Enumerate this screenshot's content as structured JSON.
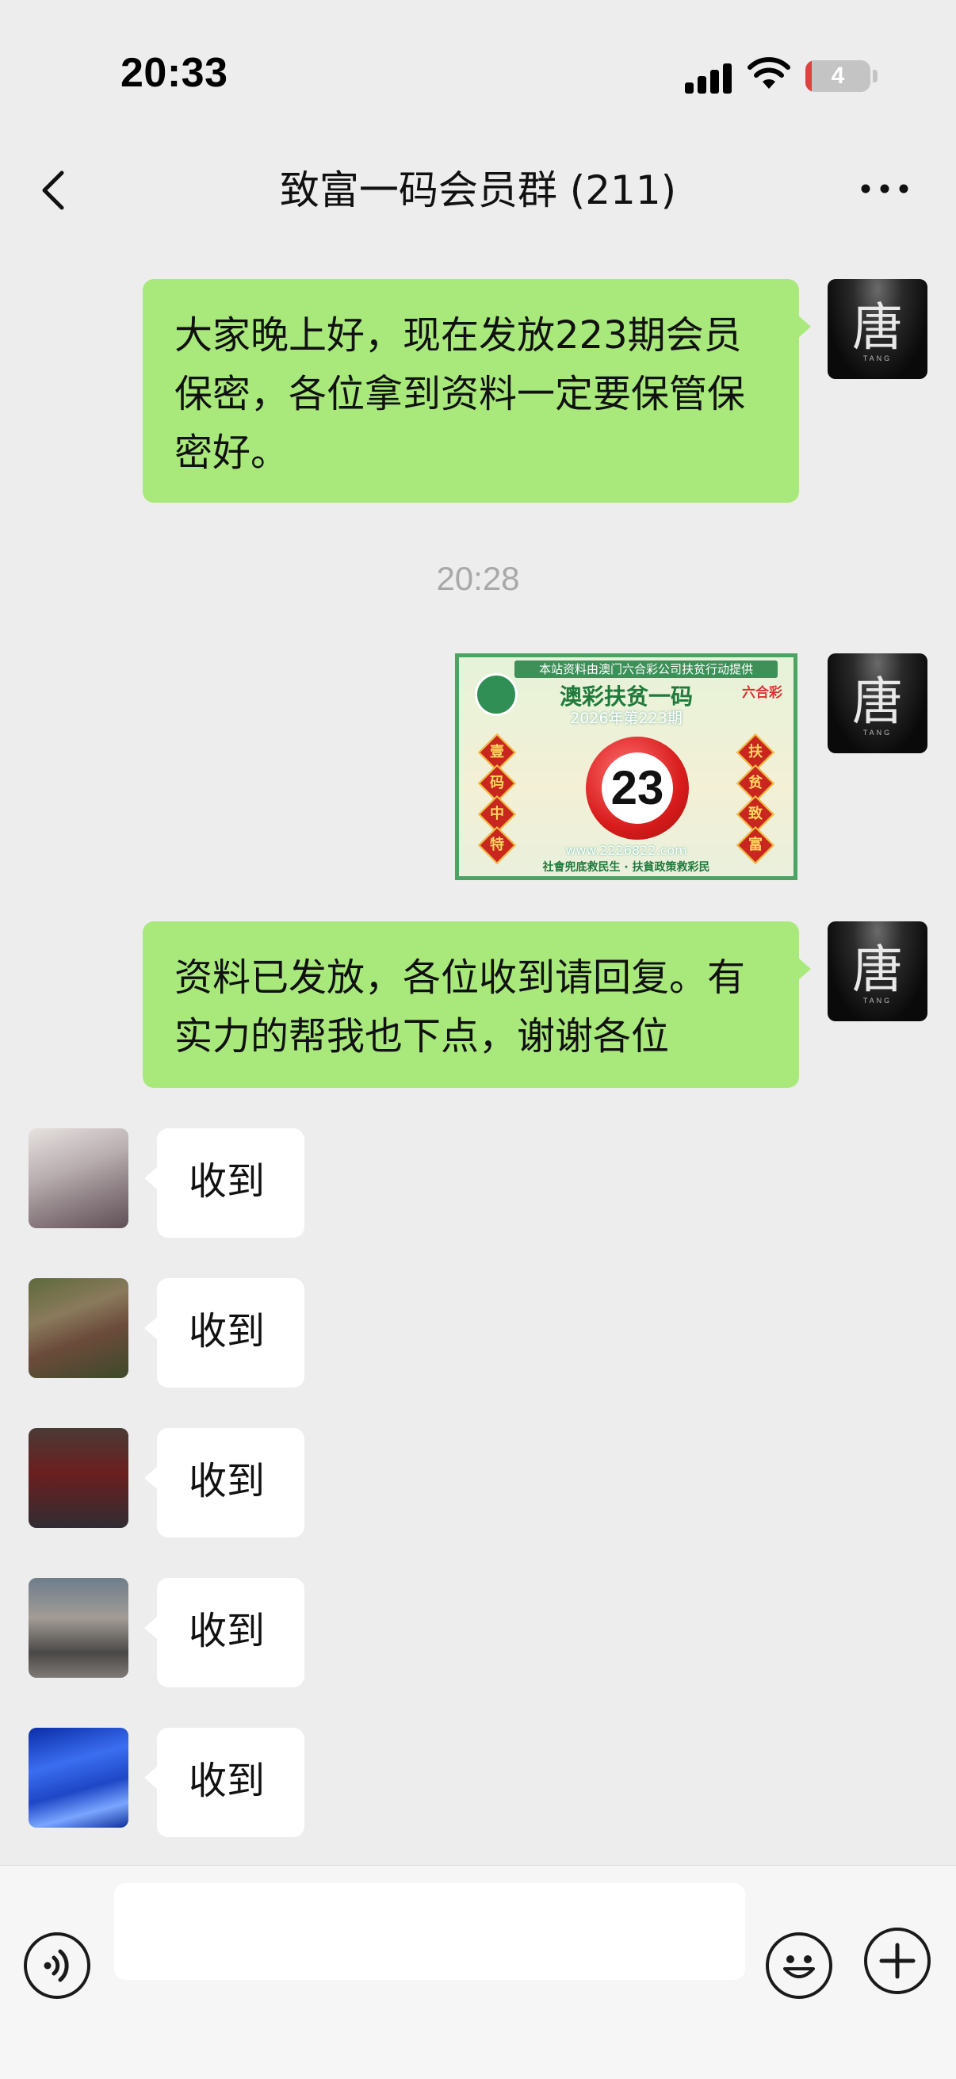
{
  "status_bar": {
    "time": "20:33",
    "battery_level": "4",
    "battery_color": "#e0403e",
    "icons": [
      "cellular-signal-icon",
      "wifi-icon",
      "battery-icon"
    ]
  },
  "nav": {
    "title": "致富一码会员群 (211)",
    "back_icon": "chevron-left-icon",
    "more_icon": "more-dots-icon"
  },
  "messages": [
    {
      "side": "right",
      "avatar_text": "唐",
      "avatar_sub": "TANG",
      "text": "大家晚上好，现在发放223期会员保密，各位拿到资料一定要保管保密好。"
    },
    {
      "side": "center",
      "timestamp": "20:28"
    },
    {
      "side": "right",
      "avatar_text": "唐",
      "avatar_sub": "TANG",
      "type": "image",
      "image": {
        "header": "本站资料由澳门六合彩公司扶贫行动提供",
        "title": "澳彩扶贫一码",
        "period": "2026年第223期",
        "logo": "六合彩",
        "number": "23",
        "left_chars": [
          "壹",
          "码",
          "中",
          "特"
        ],
        "right_chars": [
          "扶",
          "贫",
          "致",
          "富"
        ],
        "url": "www.2226822.com",
        "footer": "社會兜底救民生 · 扶貧政策救彩民"
      }
    },
    {
      "side": "right",
      "avatar_text": "唐",
      "avatar_sub": "TANG",
      "text": "资料已发放，各位收到请回复。有实力的帮我也下点，谢谢各位"
    },
    {
      "side": "left",
      "text": "收到"
    },
    {
      "side": "left",
      "text": "收到"
    },
    {
      "side": "left",
      "text": "收到"
    },
    {
      "side": "left",
      "text": "收到"
    },
    {
      "side": "left",
      "text": "收到"
    }
  ],
  "input_bar": {
    "voice_icon": "voice-icon",
    "emoji_icon": "emoji-icon",
    "plus_icon": "plus-icon",
    "placeholder": ""
  },
  "colors": {
    "background": "#ededed",
    "bubble_green": "#a9e97c",
    "bubble_white": "#ffffff",
    "timestamp": "#a8a8a8"
  }
}
